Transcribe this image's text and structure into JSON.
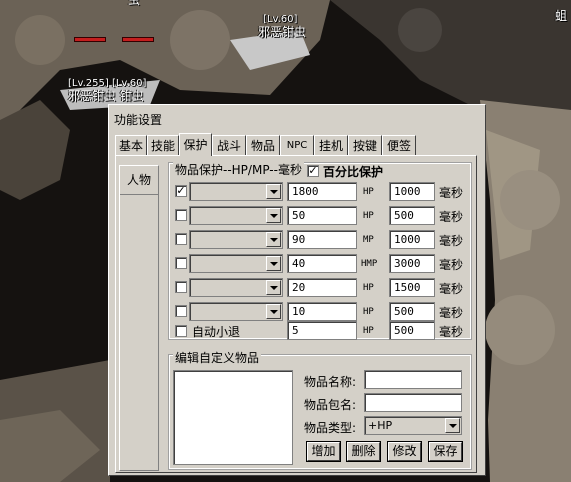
{
  "game": {
    "labels": [
      {
        "text": "虫"
      },
      {
        "text": "[Lv.60]"
      },
      {
        "text": "邪恶钳虫"
      },
      {
        "text": "[Lv.255] [Lv.60]"
      },
      {
        "text": "邪恶钳虫  钳虫"
      },
      {
        "text": "蛆"
      }
    ]
  },
  "window": {
    "title": "功能设置",
    "tabs": [
      "基本",
      "技能",
      "保护",
      "战斗",
      "物品",
      "NPC",
      "挂机",
      "按键",
      "便签"
    ],
    "active_tab": "保护",
    "side_tab": "人物",
    "item_protect": {
      "title": "物品保护--HP/MP--毫秒",
      "percent_label": "百分比保护",
      "percent_checked": true,
      "rows": [
        {
          "checked": true,
          "item": "",
          "threshold": "1800",
          "stat": "HP",
          "ms": "1000",
          "unit": "毫秒"
        },
        {
          "checked": false,
          "item": "",
          "threshold": "50",
          "stat": "HP",
          "ms": "500",
          "unit": "毫秒"
        },
        {
          "checked": false,
          "item": "",
          "threshold": "90",
          "stat": "MP",
          "ms": "1000",
          "unit": "毫秒"
        },
        {
          "checked": false,
          "item": "",
          "threshold": "40",
          "stat": "HMP",
          "ms": "3000",
          "unit": "毫秒"
        },
        {
          "checked": false,
          "item": "",
          "threshold": "20",
          "stat": "HP",
          "ms": "1500",
          "unit": "毫秒"
        },
        {
          "checked": false,
          "item": "",
          "threshold": "10",
          "stat": "HP",
          "ms": "500",
          "unit": "毫秒"
        }
      ],
      "auto_retreat": {
        "label": "自动小退",
        "checked": false,
        "threshold": "5",
        "stat": "HP",
        "ms": "500",
        "unit": "毫秒"
      }
    },
    "custom_items": {
      "title": "编辑自定义物品",
      "name_label": "物品名称:",
      "package_label": "物品包名:",
      "type_label": "物品类型:",
      "name_value": "",
      "package_value": "",
      "type_value": "+HP",
      "buttons": {
        "add": "增加",
        "delete": "删除",
        "modify": "修改",
        "save": "保存"
      }
    }
  },
  "colors": {
    "window_bg": "#d4d0c8",
    "hp_bar": "#c41e1e"
  }
}
